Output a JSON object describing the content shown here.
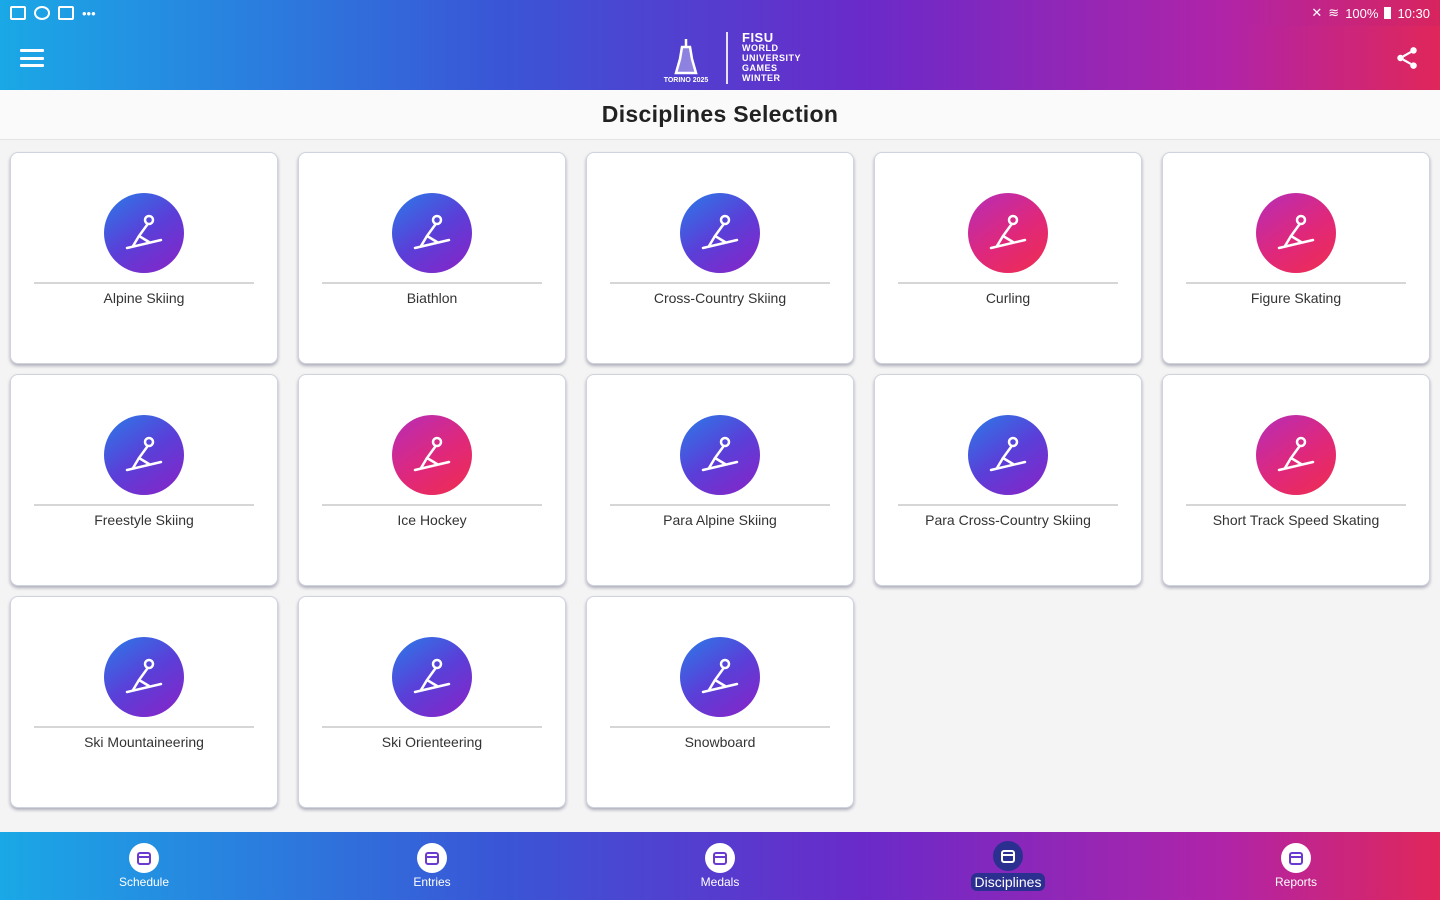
{
  "status_bar": {
    "battery": "100%",
    "time": "10:30"
  },
  "app_bar": {
    "logo_line1": "FISU",
    "logo_line2": "WORLD",
    "logo_line3": "UNIVERSITY",
    "logo_line4": "GAMES",
    "logo_line5": "WINTER",
    "logo_city": "TORINO 2025"
  },
  "page": {
    "title": "Disciplines Selection"
  },
  "disciplines": [
    {
      "label": "Alpine Skiing",
      "color": "blue",
      "icon": "alpine-skiing-icon"
    },
    {
      "label": "Biathlon",
      "color": "blue",
      "icon": "biathlon-icon"
    },
    {
      "label": "Cross-Country Skiing",
      "color": "blue",
      "icon": "cross-country-skiing-icon"
    },
    {
      "label": "Curling",
      "color": "pink",
      "icon": "curling-icon"
    },
    {
      "label": "Figure Skating",
      "color": "pink",
      "icon": "figure-skating-icon"
    },
    {
      "label": "Freestyle Skiing",
      "color": "blue",
      "icon": "freestyle-skiing-icon"
    },
    {
      "label": "Ice Hockey",
      "color": "pink",
      "icon": "ice-hockey-icon"
    },
    {
      "label": "Para Alpine Skiing",
      "color": "blue",
      "icon": "para-alpine-skiing-icon"
    },
    {
      "label": "Para Cross-Country Skiing",
      "color": "blue",
      "icon": "para-cross-country-skiing-icon"
    },
    {
      "label": "Short Track Speed Skating",
      "color": "pink",
      "icon": "short-track-icon"
    },
    {
      "label": "Ski Mountaineering",
      "color": "blue",
      "icon": "ski-mountaineering-icon"
    },
    {
      "label": "Ski Orienteering",
      "color": "blue",
      "icon": "ski-orienteering-icon"
    },
    {
      "label": "Snowboard",
      "color": "blue",
      "icon": "snowboard-icon"
    }
  ],
  "bottom_nav": [
    {
      "label": "Schedule",
      "icon": "calendar-icon",
      "active": false
    },
    {
      "label": "Entries",
      "icon": "people-icon",
      "active": false
    },
    {
      "label": "Medals",
      "icon": "medal-icon",
      "active": false
    },
    {
      "label": "Disciplines",
      "icon": "list-icon",
      "active": true
    },
    {
      "label": "Reports",
      "icon": "report-icon",
      "active": false
    }
  ],
  "colors": {
    "gradient_start": "#1aa8e6",
    "gradient_mid": "#6a2ac9",
    "gradient_end": "#e0265a",
    "active_nav": "#2b2f8f"
  }
}
